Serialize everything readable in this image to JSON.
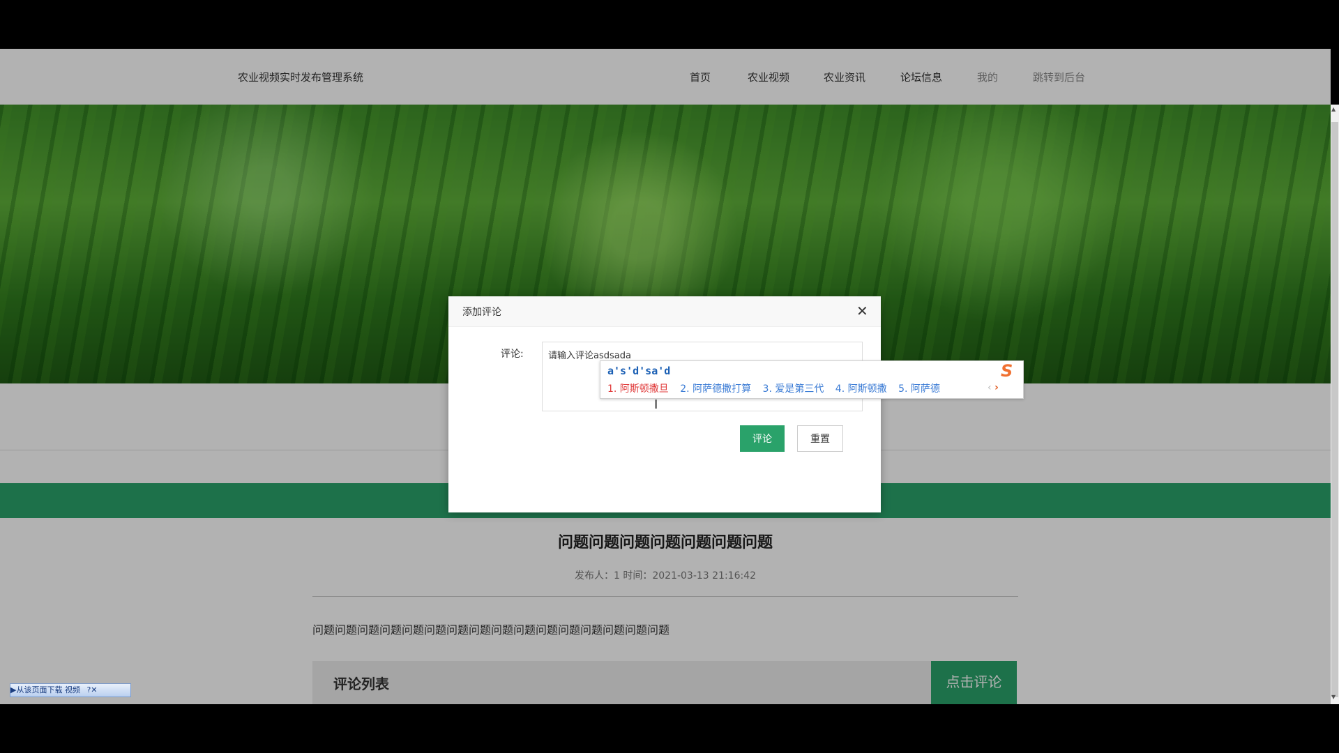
{
  "header": {
    "site_title": "农业视频实时发布管理系统",
    "nav": [
      "首页",
      "农业视频",
      "农业资讯",
      "论坛信息",
      "我的",
      "跳转到后台"
    ]
  },
  "post": {
    "title": "问题问题问题问题问题问题问题",
    "meta": "发布人：1 时间：2021-03-13 21:16:42",
    "body": "问题问题问题问题问题问题问题问题问题问题问题问题问题问题问题问题",
    "comment_list_title": "评论列表",
    "click_comment_label": "点击评论"
  },
  "dialog": {
    "title": "添加评论",
    "close_glyph": "✕",
    "field_label": "评论:",
    "textarea_value": "请输入评论asdsada",
    "submit_label": "评论",
    "reset_label": "重置"
  },
  "ime": {
    "composition": "a's'd'sa'd",
    "candidates": [
      "1. 阿斯顿撒旦",
      "2. 阿萨德撒打算",
      "3. 爱是第三代",
      "4. 阿斯顿撒",
      "5. 阿萨德"
    ],
    "prev_glyph": "‹",
    "next_glyph": "›",
    "logo_glyph": "S"
  },
  "widget": {
    "download_label": "▶从该页面下载 视频",
    "extra": "?✕"
  }
}
